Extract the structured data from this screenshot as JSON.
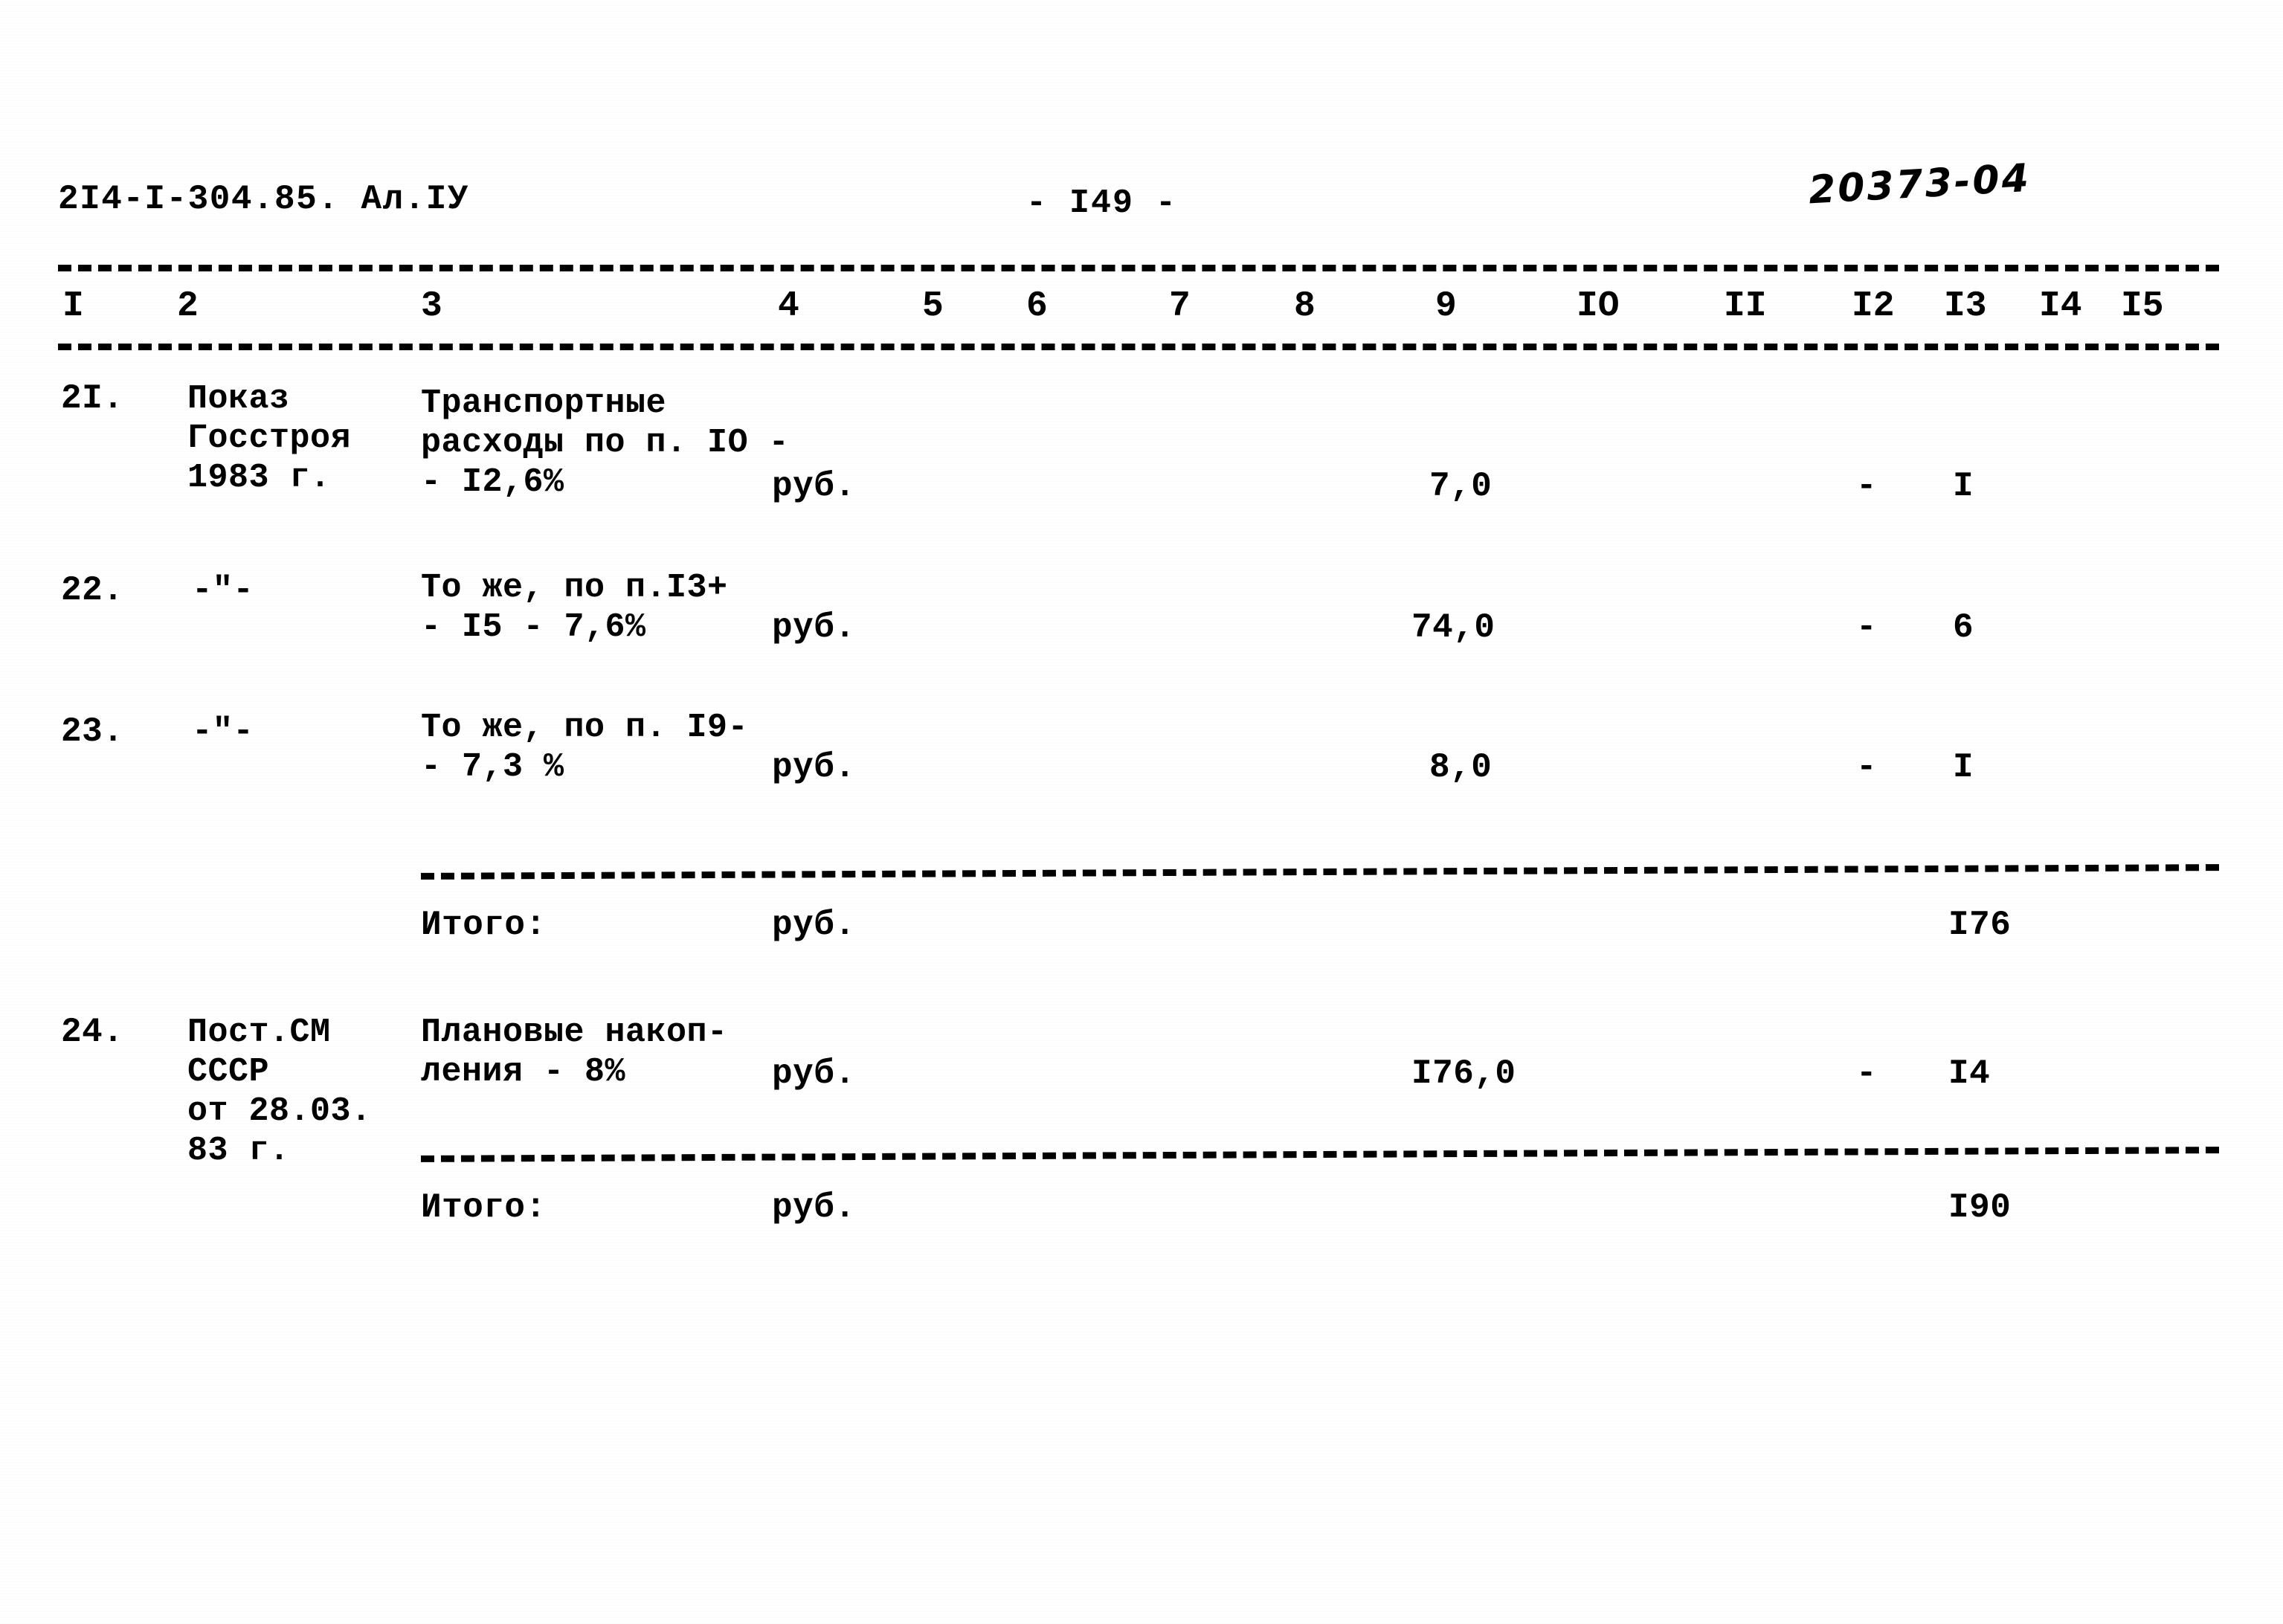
{
  "header": {
    "doc_code": "2I4-I-304.85. Ал.IУ",
    "page_number": "- I49 -",
    "handwritten_note": "20373-04"
  },
  "column_numbers": [
    "I",
    "2",
    "3",
    "4",
    "5",
    "6",
    "7",
    "8",
    "9",
    "IO",
    "II",
    "I2",
    "I3",
    "I4",
    "I5"
  ],
  "rows": [
    {
      "no": "2I.",
      "basis": "Показ\nГосстроя\n1983 г.",
      "description": "Транспортные\nрасходы по п. IO -\n- I2,6%",
      "unit": "руб.",
      "col9": "7,0",
      "col12": "-",
      "col13": "I"
    },
    {
      "no": "22.",
      "basis": "-\"-",
      "description": "То же, по п.I3+\n- I5 - 7,6%",
      "unit": "руб.",
      "col9": "74,0",
      "col12": "-",
      "col13": "6"
    },
    {
      "no": "23.",
      "basis": "-\"-",
      "description": "То же, по п. I9-\n- 7,3 %",
      "unit": "руб.",
      "col9": "8,0",
      "col12": "-",
      "col13": "I"
    },
    {
      "no": "24.",
      "basis": "Пост.СМ\nСССР\nот 28.03.\n83 г.",
      "description": "Плановые накоп-\nления - 8%",
      "unit": "руб.",
      "col9": "I76,0",
      "col12": "-",
      "col13": "I4"
    }
  ],
  "totals": [
    {
      "label": "Итого:",
      "unit": "руб.",
      "col13": "I76"
    },
    {
      "label": "Итого:",
      "unit": "руб.",
      "col13": "I90"
    }
  ]
}
